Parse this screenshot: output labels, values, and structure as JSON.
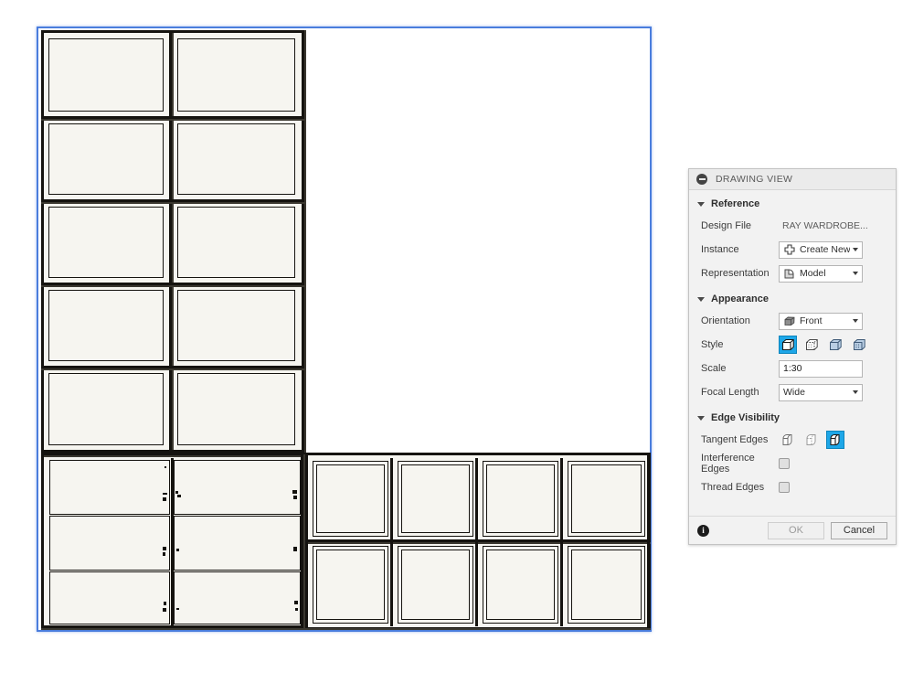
{
  "canvas": {
    "name": "drawing-canvas",
    "selection_frame_color": "#4a7ddd",
    "background": "#ffffff",
    "drawing_description": "Front orthographic view of a wardrobe / shelving unit",
    "linework_color": "#15130f",
    "face_fill": "#f6f5f0"
  },
  "drawing": {
    "tall_unit": {
      "columns": 2,
      "rows": 5
    },
    "drawer_unit": {
      "columns": 2,
      "rows": 3
    },
    "lower_right_unit": {
      "columns": 4,
      "rows": 2
    }
  },
  "dialog": {
    "title": "DRAWING VIEW",
    "collapse_icon": "minus-circle-icon",
    "sections": {
      "reference": {
        "label": "Reference",
        "caret": "caret-down-icon",
        "rows": {
          "design_file": {
            "label": "Design File",
            "value": "RAY WARDROBE..."
          },
          "instance": {
            "label": "Instance",
            "value": "Create New",
            "icon": "create-new-icon",
            "arrow": "chevron-down-icon"
          },
          "representation": {
            "label": "Representation",
            "value": "Model",
            "icon": "model-icon",
            "arrow": "chevron-down-icon"
          }
        }
      },
      "appearance": {
        "label": "Appearance",
        "caret": "caret-down-icon",
        "rows": {
          "orientation": {
            "label": "Orientation",
            "value": "Front",
            "icon": "cube-orientation-icon",
            "arrow": "chevron-down-icon"
          },
          "style": {
            "label": "Style",
            "selected_index": 0,
            "options": [
              {
                "name": "visible-edges-icon",
                "selected": true
              },
              {
                "name": "visible-and-hidden-edges-icon",
                "selected": false
              },
              {
                "name": "shaded-icon",
                "selected": false
              },
              {
                "name": "shaded-with-hidden-edges-icon",
                "selected": false
              }
            ]
          },
          "scale": {
            "label": "Scale",
            "value": "1:30"
          },
          "focal_length": {
            "label": "Focal Length",
            "value": "Wide",
            "arrow": "chevron-down-icon"
          }
        }
      },
      "edge_visibility": {
        "label": "Edge Visibility",
        "caret": "caret-down-icon",
        "rows": {
          "tangent_edges": {
            "label": "Tangent Edges",
            "selected_index": 2,
            "options": [
              {
                "name": "tangent-edges-off-icon",
                "selected": false
              },
              {
                "name": "tangent-edges-dimmed-icon",
                "selected": false
              },
              {
                "name": "tangent-edges-on-icon",
                "selected": true
              }
            ]
          },
          "interference_edges": {
            "label": "Interference Edges",
            "checked": false
          },
          "thread_edges": {
            "label": "Thread Edges",
            "checked": false
          }
        }
      }
    },
    "footer": {
      "info_icon": "info-icon",
      "info_glyph": "i",
      "ok_label": "OK",
      "cancel_label": "Cancel"
    },
    "accent_color": "#1ea7e8"
  }
}
